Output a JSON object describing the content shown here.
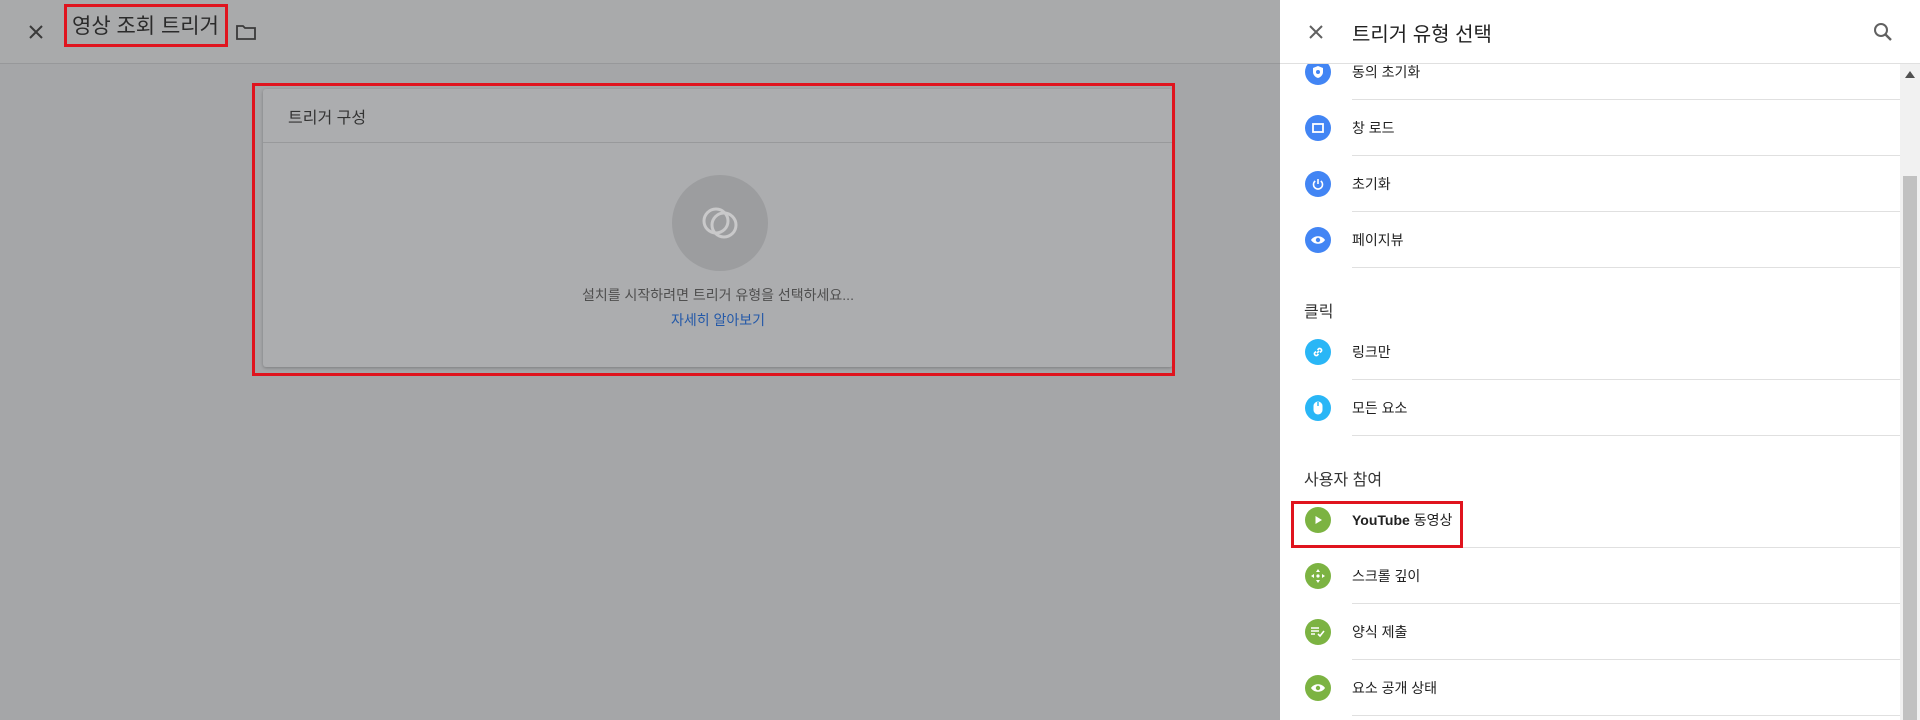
{
  "editor": {
    "title": "영상 조회 트리거",
    "card_title": "트리거 구성",
    "hint": "설치를 시작하려면 트리거 유형을 선택하세요...",
    "learn_more": "자세히 알아보기"
  },
  "panel": {
    "title": "트리거 유형 선택",
    "items_top": [
      {
        "label": "동의 초기화",
        "icon": "consent-shield-icon",
        "color": "#4285f4"
      },
      {
        "label": "창 로드",
        "icon": "window-icon",
        "color": "#4285f4"
      },
      {
        "label": "초기화",
        "icon": "power-icon",
        "color": "#4285f4"
      },
      {
        "label": "페이지뷰",
        "icon": "eye-icon",
        "color": "#4285f4"
      }
    ],
    "sections": {
      "click": "클릭",
      "engagement": "사용자 참여"
    },
    "items_click": [
      {
        "label": "링크만",
        "icon": "link-icon",
        "color": "#29b6f6"
      },
      {
        "label": "모든 요소",
        "icon": "mouse-icon",
        "color": "#29b6f6"
      }
    ],
    "items_engagement": [
      {
        "label": "YouTube 동영상",
        "label_brand": "YouTube",
        "label_rest": " 동영상",
        "icon": "play-icon",
        "color": "#7cb342"
      },
      {
        "label": "스크롤 깊이",
        "icon": "scroll-arrows-icon",
        "color": "#7cb342"
      },
      {
        "label": "양식 제출",
        "icon": "form-check-icon",
        "color": "#7cb342"
      },
      {
        "label": "요소 공개 상태",
        "icon": "eye-icon",
        "color": "#7cb342"
      }
    ]
  }
}
